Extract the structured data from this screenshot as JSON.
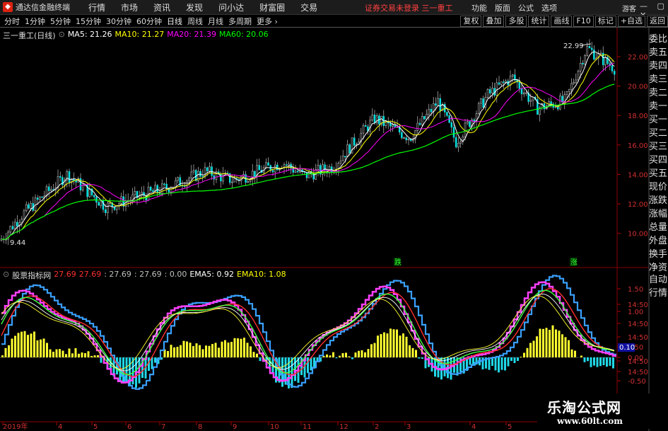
{
  "titlebar": {
    "app_name": "通达信金融终端",
    "menu": [
      "行情",
      "市场",
      "资讯",
      "发现",
      "问小达",
      "财富圈",
      "交易"
    ],
    "notice": "证券交易未登录  三一重工",
    "right_menu": [
      "功能",
      "版面",
      "公式",
      "选项"
    ],
    "guest": "游客",
    "window_buttons": "— ▢ ✕"
  },
  "periodbar": {
    "periods": [
      "分时",
      "1分钟",
      "5分钟",
      "15分钟",
      "30分钟",
      "60分钟",
      "日线",
      "周线",
      "月线",
      "多周期",
      "更多 ›"
    ],
    "active": "日线",
    "tools": [
      "复权",
      "叠加",
      "多股",
      "统计",
      "画线",
      "F10",
      "标记",
      "+自选",
      "返回"
    ]
  },
  "main_legend": {
    "stock": "三一重工(日线)",
    "items": [
      {
        "label": "MA5: 21.26",
        "color": "#ffffff"
      },
      {
        "label": "MA10: 21.27",
        "color": "#ffff00"
      },
      {
        "label": "MA20: 21.39",
        "color": "#ff00ff"
      },
      {
        "label": "MA60: 20.06",
        "color": "#00ff00"
      }
    ]
  },
  "sub_legend": {
    "name": "股票指标网",
    "items": [
      {
        "label": "27.69",
        "color": "#ff3030"
      },
      {
        "label": "27.69",
        "color": "#ff3030"
      },
      {
        "label": ": 27.69",
        "color": "#c0c0c0"
      },
      {
        "label": ": 27.69",
        "color": "#c0c0c0"
      },
      {
        "label": ": 0.00",
        "color": "#c0c0c0"
      },
      {
        "label": "EMA5: 0.92",
        "color": "#ffffff"
      },
      {
        "label": "EMA10: 1.08",
        "color": "#ffff00"
      }
    ]
  },
  "price_axis": [
    "22.00",
    "20.00",
    "18.00",
    "16.00",
    "14.00",
    "12.00",
    "10.00"
  ],
  "indicator_axis": [
    "1.50",
    "14:50",
    "1.00",
    "14:50",
    "14:50",
    "0.50",
    "14:50",
    "0.00",
    "14:50",
    "-0.50"
  ],
  "indicator_current": "0.10",
  "annotations": {
    "high": "22.99",
    "low": "9.44",
    "event_1": "跌",
    "event_2": "涨"
  },
  "time_axis": [
    "2019年",
    "4",
    "5",
    "6",
    "7",
    "8",
    "9",
    "10",
    "11",
    "12",
    "2",
    "3",
    "4",
    "5"
  ],
  "right_panel": [
    "委比",
    "卖五",
    "卖四",
    "卖三",
    "卖二",
    "卖一",
    "买一",
    "买二",
    "买三",
    "买四",
    "买五",
    "现价",
    "涨跌",
    "涨幅",
    "总量",
    "外盘",
    "换手",
    "净资",
    "收益"
  ],
  "right_panel2": [
    "自动",
    "行情"
  ],
  "watermark": {
    "title": "乐淘公式网",
    "url": "www.60lt.com"
  }
}
